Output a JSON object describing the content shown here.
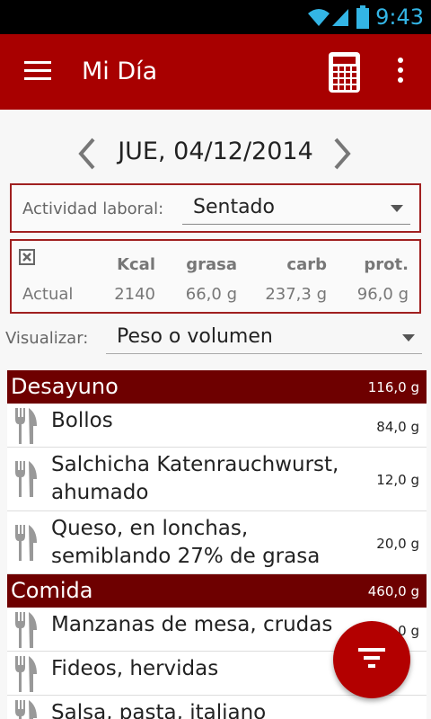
{
  "status_bar": {
    "time": "9:43"
  },
  "app_bar": {
    "title": "Mi Día"
  },
  "date_nav": {
    "date": "JUE, 04/12/2014"
  },
  "activity": {
    "label": "Actividad laboral:",
    "value": "Sentado"
  },
  "summary": {
    "headers": [
      "Kcal",
      "grasa",
      "carb",
      "prot."
    ],
    "row_label": "Actual",
    "values": [
      "2140",
      "66,0 g",
      "237,3 g",
      "96,0 g"
    ]
  },
  "visualize": {
    "label": "Visualizar:",
    "value": "Peso o volumen"
  },
  "meals": [
    {
      "name": "Desayuno",
      "weight": "116,0 g",
      "items": [
        {
          "name": "Bollos",
          "weight": "84,0 g"
        },
        {
          "name": "Salchicha Katenrauchwurst,\nahumado",
          "weight": "12,0 g"
        },
        {
          "name": "Queso, en lonchas,\nsemiblando 27% de grasa",
          "weight": "20,0 g"
        }
      ]
    },
    {
      "name": "Comida",
      "weight": "460,0 g",
      "items": [
        {
          "name": "Manzanas de mesa, crudas",
          "weight": "200,0 g"
        },
        {
          "name": "Fideos, hervidas",
          "weight": ""
        },
        {
          "name": "Salsa, pasta, italiano",
          "weight": ""
        }
      ]
    }
  ],
  "colors": {
    "primary": "#a80000",
    "header_dark": "#6e0000",
    "status_accent": "#33b5e5"
  },
  "icons": [
    "menu-icon",
    "calculator-icon",
    "overflow-icon",
    "chevron-left-icon",
    "chevron-right-icon",
    "close-box-icon",
    "dropdown-icon",
    "fork-knife-icon",
    "filter-icon",
    "wifi-icon",
    "signal-icon",
    "battery-icon"
  ]
}
